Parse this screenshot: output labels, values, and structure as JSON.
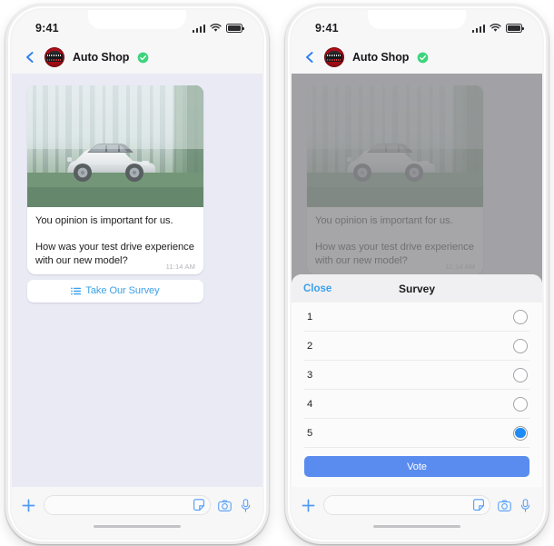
{
  "accent_blue": "#3ca0e8",
  "vote_blue": "#5a8cf0",
  "radio_blue": "#1f8cf5",
  "verified_green": "#3ed47d",
  "avatar_red": "#a50e18",
  "chat_background": "#e9eaf4",
  "phones": [
    {
      "id": "left",
      "status": {
        "time": "9:41",
        "signal_icon": "signal-bars-icon",
        "wifi_icon": "wifi-icon",
        "battery_icon": "battery-icon"
      },
      "nav": {
        "back_icon": "back-chevron-icon",
        "avatar_icon": "auto-shop-avatar",
        "title": "Auto Shop",
        "verified_icon": "verified-badge-icon"
      },
      "message": {
        "image_alt": "white-suv-in-foggy-forest",
        "line1": "You opinion is important for us.",
        "line2": "How was your test drive experience with our new model?",
        "time": "11:14 AM"
      },
      "survey_button": {
        "icon": "list-icon",
        "label": "Take Our Survey"
      },
      "toolbar": {
        "plus_icon": "plus-icon",
        "input_placeholder": "",
        "input_value": "",
        "sticker_icon": "sticker-icon",
        "camera_icon": "camera-icon",
        "mic_icon": "microphone-icon"
      }
    },
    {
      "id": "right",
      "status": {
        "time": "9:41",
        "signal_icon": "signal-bars-icon",
        "wifi_icon": "wifi-icon",
        "battery_icon": "battery-icon"
      },
      "nav": {
        "back_icon": "back-chevron-icon",
        "avatar_icon": "auto-shop-avatar",
        "title": "Auto Shop",
        "verified_icon": "verified-badge-icon"
      },
      "message": {
        "image_alt": "white-suv-in-foggy-forest",
        "line1": "You opinion is important for us.",
        "line2": "How was your test drive experience with our new model?",
        "time": "11:14 AM"
      },
      "survey_button": {
        "icon": "list-icon",
        "label": "Take Our Survey"
      },
      "sheet": {
        "close_label": "Close",
        "title": "Survey",
        "options": [
          {
            "label": "1",
            "selected": false
          },
          {
            "label": "2",
            "selected": false
          },
          {
            "label": "3",
            "selected": false
          },
          {
            "label": "4",
            "selected": false
          },
          {
            "label": "5",
            "selected": true
          }
        ],
        "vote_label": "Vote"
      },
      "toolbar": {
        "plus_icon": "plus-icon",
        "input_placeholder": "",
        "input_value": "",
        "sticker_icon": "sticker-icon",
        "camera_icon": "camera-icon",
        "mic_icon": "microphone-icon"
      }
    }
  ]
}
